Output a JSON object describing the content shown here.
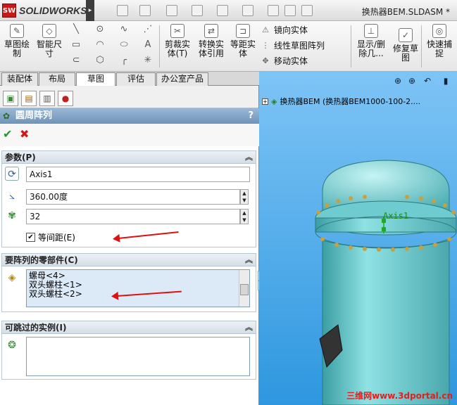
{
  "app": {
    "logo_mark": "SW",
    "name": "SOLIDWORKS",
    "menu_arrow": "▸"
  },
  "window": {
    "title": "换热器BEM.SLDASM *"
  },
  "ribbon": {
    "sketch_label": "草图绘\n制",
    "smart_dim_label": "智能尺\n寸",
    "trim_label": "剪裁实\n体(T)",
    "convert_label": "转换实\n体引用",
    "offset_label": "等距实\n体",
    "mirror_label": "镜向实体",
    "linear_pattern_label": "线性草图阵列",
    "move_label": "移动实体",
    "show_delete_label": "显示/删\n除几...",
    "repair_label": "修复草\n图",
    "quick_snap_label": "快速捕\n捉"
  },
  "tabs": [
    {
      "label": "装配体"
    },
    {
      "label": "布局"
    },
    {
      "label": "草图"
    },
    {
      "label": "评估"
    },
    {
      "label": "办公室产品"
    }
  ],
  "panel": {
    "title": "圆周阵列",
    "help": "?",
    "ok": "✔",
    "cancel": "✖",
    "params": {
      "header": "参数(P)",
      "axis": "Axis1",
      "angle": "360.00度",
      "count": "32",
      "equal_spacing": "等间距(E)"
    },
    "components": {
      "header": "要阵列的零部件(C)",
      "items": [
        "螺母<4>",
        "双头螺柱<1>",
        "双头螺柱<2>"
      ]
    },
    "skip": {
      "header": "可跳过的实例(I)"
    }
  },
  "viewport": {
    "tree_item": "换热器BEM  (换热器BEM1000-100-2....",
    "axis_label": "Axis1",
    "bg_top": "#7ec4f6",
    "bg_bottom": "#2e97df",
    "model_color": "#7fd6d8"
  },
  "watermark": "三维网www.3dportal.cn"
}
